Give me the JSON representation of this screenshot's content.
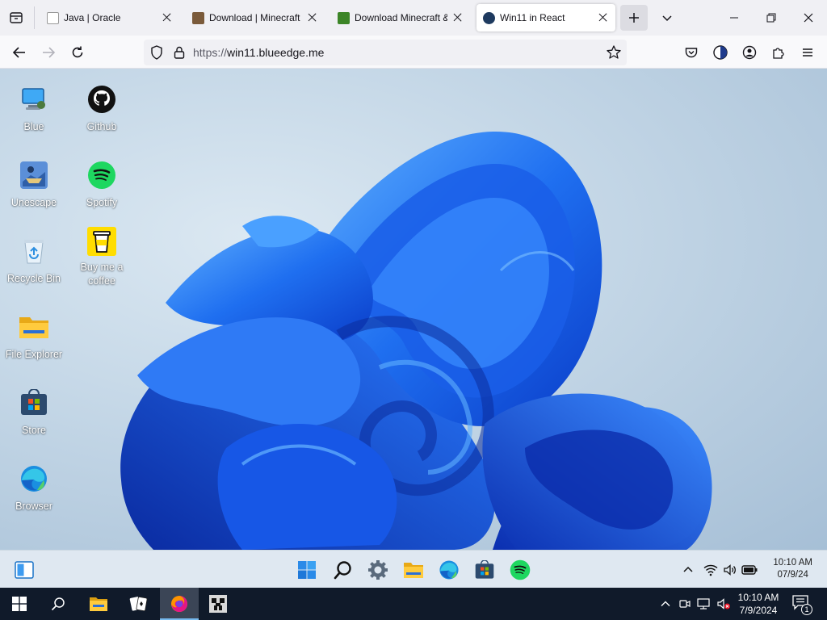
{
  "browser": {
    "tabs": [
      {
        "label": "Java | Oracle",
        "favicon_color": "#c74634",
        "active": false
      },
      {
        "label": "Download | Minecraft Ja",
        "favicon_color": "#6a8f3a",
        "active": false
      },
      {
        "label": "Download Minecraft & M",
        "favicon_color": "#3c8527",
        "active": false
      },
      {
        "label": "Win11 in React",
        "favicon_color": "#1e3a5f",
        "active": true
      }
    ],
    "url_scheme": "https://",
    "url_host": "win11.blueedge.me",
    "accent": "#0061e0"
  },
  "desktop": {
    "icons": [
      {
        "label": "Blue",
        "icon": "computer-icon"
      },
      {
        "label": "Github",
        "icon": "github-icon"
      },
      {
        "label": "Unescape",
        "icon": "unescape-icon"
      },
      {
        "label": "Spotify",
        "icon": "spotify-icon"
      },
      {
        "label": "Recycle Bin",
        "icon": "recycle-bin-icon"
      },
      {
        "label": "Buy me a coffee",
        "icon": "coffee-icon"
      },
      {
        "label": "File Explorer",
        "icon": "folder-icon"
      },
      {
        "label": "Store",
        "icon": "store-icon"
      },
      {
        "label": "Browser",
        "icon": "edge-icon"
      }
    ],
    "wallpaper_colors": [
      "#0a3fd8",
      "#1f6ff0",
      "#4aa0ff"
    ]
  },
  "w11_taskbar": {
    "apps": [
      "start-icon",
      "search-icon",
      "settings-icon",
      "file-explorer-icon",
      "edge-icon",
      "store-icon",
      "spotify-icon"
    ],
    "time": "10:10 AM",
    "date": "07/9/24"
  },
  "host_taskbar": {
    "apps": [
      "start-icon",
      "search-icon",
      "file-explorer-icon",
      "solitaire-icon",
      "firefox-icon",
      "minecraft-icon"
    ],
    "time": "10:10 AM",
    "date": "7/9/2024",
    "notification_count": "1"
  }
}
